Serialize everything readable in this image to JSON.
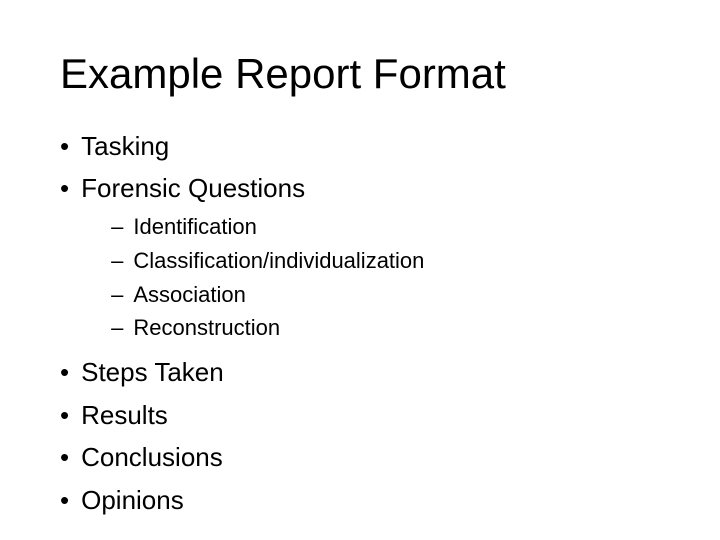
{
  "slide": {
    "title": "Example Report Format",
    "bullets": [
      {
        "id": "tasking",
        "text": "Tasking",
        "sub_items": []
      },
      {
        "id": "forensic-questions",
        "text": "Forensic Questions",
        "sub_items": [
          "Identification",
          "Classification/individualization",
          "Association",
          "Reconstruction"
        ]
      },
      {
        "id": "steps-taken",
        "text": "Steps Taken",
        "sub_items": []
      },
      {
        "id": "results",
        "text": "Results",
        "sub_items": []
      },
      {
        "id": "conclusions",
        "text": "Conclusions",
        "sub_items": []
      },
      {
        "id": "opinions",
        "text": "Opinions",
        "sub_items": []
      }
    ],
    "bullet_symbol": "•",
    "dash_symbol": "–"
  }
}
